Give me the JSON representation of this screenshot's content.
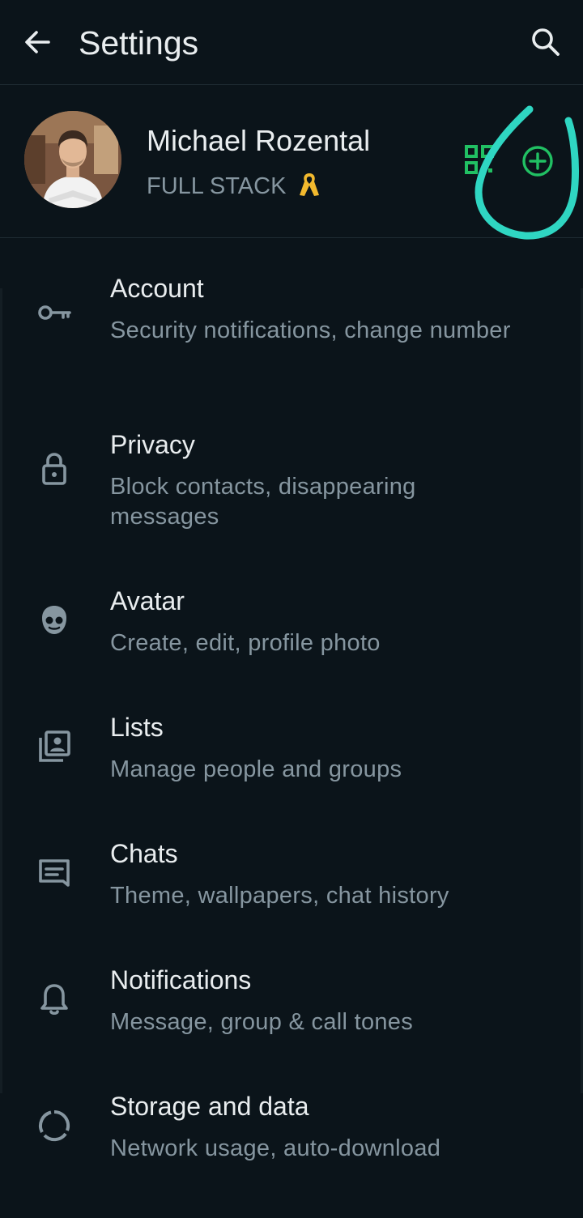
{
  "header": {
    "title": "Settings",
    "back_icon": "arrow-back-icon",
    "search_icon": "search-icon"
  },
  "profile": {
    "name": "Michael Rozental",
    "status": "FULL STACK",
    "status_emoji": "yellow-ribbon",
    "qr_icon": "qr-code-icon",
    "add_icon": "plus-circle-icon",
    "annotation_color": "#2fd6c2"
  },
  "menu": [
    {
      "label": "Account",
      "subtitle": "Security notifications, change number",
      "icon": "key-icon"
    },
    {
      "label": "Privacy",
      "subtitle": "Block contacts, disappearing messages",
      "icon": "lock-icon"
    },
    {
      "label": "Avatar",
      "subtitle": "Create, edit, profile photo",
      "icon": "avatar-face-icon"
    },
    {
      "label": "Lists",
      "subtitle": "Manage people and groups",
      "icon": "contact-list-icon"
    },
    {
      "label": "Chats",
      "subtitle": "Theme, wallpapers, chat history",
      "icon": "chat-icon"
    },
    {
      "label": "Notifications",
      "subtitle": "Message, group & call tones",
      "icon": "bell-icon"
    },
    {
      "label": "Storage and data",
      "subtitle": "Network usage, auto-download",
      "icon": "storage-ring-icon"
    }
  ],
  "colors": {
    "background": "#0b141a",
    "text_primary": "#e9edef",
    "text_secondary": "#8696a0",
    "accent_green": "#21c063",
    "icon_gray": "#8696a0"
  }
}
